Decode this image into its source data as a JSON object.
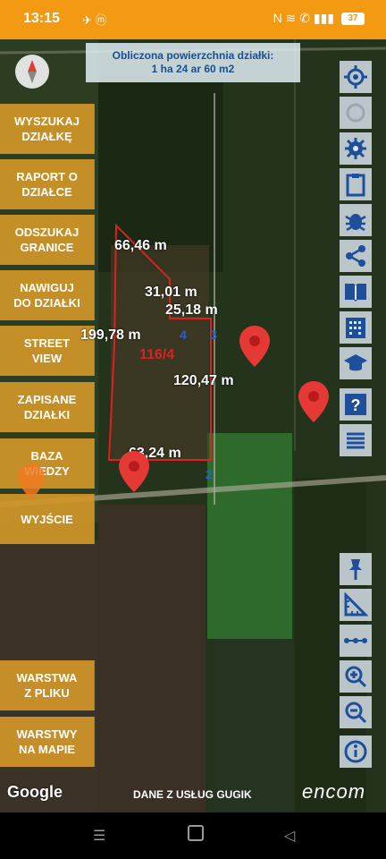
{
  "status": {
    "time": "13:15",
    "app_icons": "✈ ⓜ",
    "battery": "37",
    "right_icons": "N ≋ ✆ ▮▮▮"
  },
  "area": {
    "line1": "Obliczona powierzchnia działki:",
    "line2": "1 ha 24 ar 60 m2"
  },
  "menu": [
    "WYSZUKAJ\nDZIAŁKĘ",
    "RAPORT O\nDZIAŁCE",
    "ODSZUKAJ\nGRANICE",
    "NAWIGUJ\nDO DZIAŁKI",
    "STREET\nVIEW",
    "ZAPISANE\nDZIAŁKI",
    "BAZA\nWIEDZY",
    "WYJŚCIE",
    "WARSTWA\nZ PLIKU",
    "WARSTWY\nNA MAPIE"
  ],
  "tools": [
    "target-icon",
    "target-disabled-icon",
    "gear-icon",
    "clipboard-icon",
    "bug-icon",
    "share-icon",
    "book-icon",
    "building-icon",
    "graduation-cap-icon",
    "help-icon",
    "list-icon",
    "pin-icon",
    "ruler-icon",
    "distance-icon",
    "zoom-in-icon",
    "zoom-out-icon",
    "info-icon"
  ],
  "measurements": {
    "m1": "66,46 m",
    "m2": "31,01 m",
    "m3": "25,18 m",
    "m4": "199,78 m",
    "m5": "120,47 m",
    "m6": "63,24 m"
  },
  "parcel_id": "116/4",
  "vertex": {
    "v2": "2",
    "v3": "3",
    "v4": "4"
  },
  "footer": {
    "google": "Google",
    "source": "DANE Z USŁUG GUGIK",
    "brand": "encom"
  },
  "colors": {
    "accent": "#f39a12",
    "menu": "#d39628",
    "tool_icon": "#1f4f9a",
    "parcel": "#e02020",
    "pin": "#e53935"
  }
}
